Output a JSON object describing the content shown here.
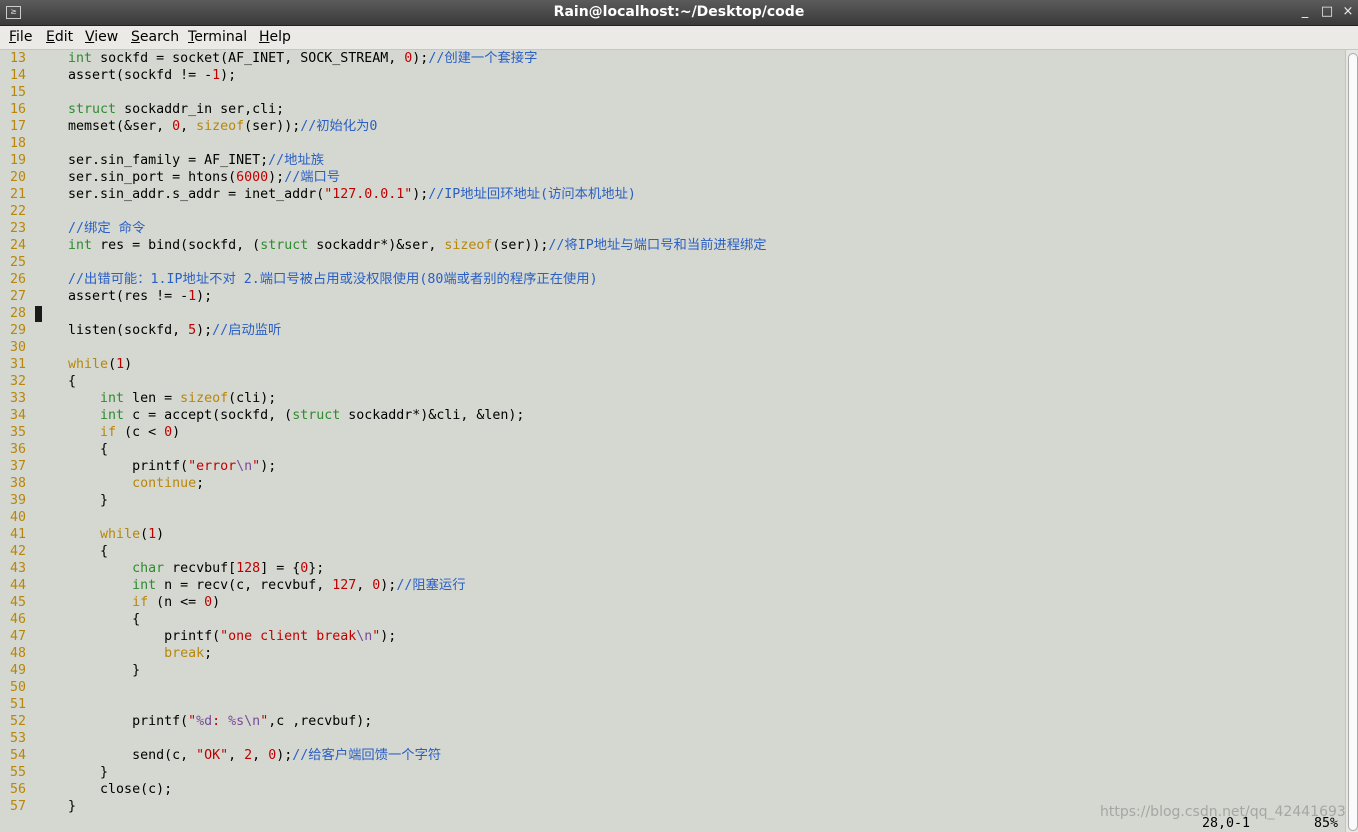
{
  "window": {
    "title": "Rain@localhost:~/Desktop/code",
    "icon": "terminal-icon",
    "controls": [
      "minimize-icon",
      "maximize-icon",
      "close-icon"
    ],
    "minimize_glyph": "_",
    "maximize_glyph": "□",
    "close_glyph": "×",
    "app_icon_glyph": "≥"
  },
  "menu": [
    {
      "pre": "",
      "u": "F",
      "post": "ile"
    },
    {
      "pre": "",
      "u": "E",
      "post": "dit"
    },
    {
      "pre": "",
      "u": "V",
      "post": "iew"
    },
    {
      "pre": "",
      "u": "S",
      "post": "earch"
    },
    {
      "pre": "",
      "u": "T",
      "post": "erminal"
    },
    {
      "pre": "",
      "u": "H",
      "post": "elp"
    }
  ],
  "editor": {
    "cursor_line": 28,
    "lines": [
      {
        "n": "13",
        "t": [
          [
            "    ",
            ""
          ],
          [
            "int",
            "type"
          ],
          [
            " sockfd = socket(AF_INET, SOCK_STREAM, ",
            ""
          ],
          [
            "0",
            "num"
          ],
          [
            ");",
            ""
          ],
          [
            "//创建一个套接字",
            "cmt"
          ]
        ]
      },
      {
        "n": "14",
        "t": [
          [
            "    assert(sockfd != -",
            ""
          ],
          [
            "1",
            "num"
          ],
          [
            ");",
            ""
          ]
        ]
      },
      {
        "n": "15",
        "t": []
      },
      {
        "n": "16",
        "t": [
          [
            "    ",
            ""
          ],
          [
            "struct",
            "type"
          ],
          [
            " sockaddr_in ser,cli;",
            ""
          ]
        ]
      },
      {
        "n": "17",
        "t": [
          [
            "    memset(&ser, ",
            ""
          ],
          [
            "0",
            "num"
          ],
          [
            ", ",
            ""
          ],
          [
            "sizeof",
            "kw"
          ],
          [
            "(ser));",
            ""
          ],
          [
            "//初始化为0",
            "cmt"
          ]
        ]
      },
      {
        "n": "18",
        "t": []
      },
      {
        "n": "19",
        "t": [
          [
            "    ser.sin_family = AF_INET;",
            ""
          ],
          [
            "//地址族",
            "cmt"
          ]
        ]
      },
      {
        "n": "20",
        "t": [
          [
            "    ser.sin_port = htons(",
            ""
          ],
          [
            "6000",
            "num"
          ],
          [
            ");",
            ""
          ],
          [
            "//端口号",
            "cmt"
          ]
        ]
      },
      {
        "n": "21",
        "t": [
          [
            "    ser.sin_addr.s_addr = inet_addr(",
            ""
          ],
          [
            "\"127.0.0.1\"",
            "str"
          ],
          [
            ");",
            ""
          ],
          [
            "//IP地址回环地址(访问本机地址)",
            "cmt"
          ]
        ]
      },
      {
        "n": "22",
        "t": []
      },
      {
        "n": "23",
        "t": [
          [
            "    ",
            ""
          ],
          [
            "//绑定 命令",
            "cmt"
          ]
        ]
      },
      {
        "n": "24",
        "t": [
          [
            "    ",
            ""
          ],
          [
            "int",
            "type"
          ],
          [
            " res = bind(sockfd, (",
            ""
          ],
          [
            "struct",
            "type"
          ],
          [
            " sockaddr*)&ser, ",
            ""
          ],
          [
            "sizeof",
            "kw"
          ],
          [
            "(ser));",
            ""
          ],
          [
            "//将IP地址与端口号和当前进程绑定",
            "cmt"
          ]
        ]
      },
      {
        "n": "25",
        "t": []
      },
      {
        "n": "26",
        "t": [
          [
            "    ",
            ""
          ],
          [
            "//出错可能：1.IP地址不对 2.端口号被占用或没权限使用(80端或者别的程序正在使用)",
            "cmt"
          ]
        ]
      },
      {
        "n": "27",
        "t": [
          [
            "    assert(res != -",
            ""
          ],
          [
            "1",
            "num"
          ],
          [
            ");",
            ""
          ]
        ]
      },
      {
        "n": "28",
        "t": []
      },
      {
        "n": "29",
        "t": [
          [
            "    listen(sockfd, ",
            ""
          ],
          [
            "5",
            "num"
          ],
          [
            ");",
            ""
          ],
          [
            "//启动监听",
            "cmt"
          ]
        ]
      },
      {
        "n": "30",
        "t": []
      },
      {
        "n": "31",
        "t": [
          [
            "    ",
            ""
          ],
          [
            "while",
            "kw"
          ],
          [
            "(",
            ""
          ],
          [
            "1",
            "num"
          ],
          [
            ")",
            ""
          ]
        ]
      },
      {
        "n": "32",
        "t": [
          [
            "    {",
            ""
          ]
        ]
      },
      {
        "n": "33",
        "t": [
          [
            "        ",
            ""
          ],
          [
            "int",
            "type"
          ],
          [
            " len = ",
            ""
          ],
          [
            "sizeof",
            "kw"
          ],
          [
            "(cli);",
            ""
          ]
        ]
      },
      {
        "n": "34",
        "t": [
          [
            "        ",
            ""
          ],
          [
            "int",
            "type"
          ],
          [
            " c = accept(sockfd, (",
            ""
          ],
          [
            "struct",
            "type"
          ],
          [
            " sockaddr*)&cli, &len);",
            ""
          ]
        ]
      },
      {
        "n": "35",
        "t": [
          [
            "        ",
            ""
          ],
          [
            "if",
            "kw"
          ],
          [
            " (c < ",
            ""
          ],
          [
            "0",
            "num"
          ],
          [
            ")",
            ""
          ]
        ]
      },
      {
        "n": "36",
        "t": [
          [
            "        {",
            ""
          ]
        ]
      },
      {
        "n": "37",
        "t": [
          [
            "            printf(",
            ""
          ],
          [
            "\"error",
            "str"
          ],
          [
            "\\n",
            "esc"
          ],
          [
            "\"",
            "str"
          ],
          [
            ");",
            ""
          ]
        ]
      },
      {
        "n": "38",
        "t": [
          [
            "            ",
            ""
          ],
          [
            "continue",
            "kw"
          ],
          [
            ";",
            ""
          ]
        ]
      },
      {
        "n": "39",
        "t": [
          [
            "        }",
            ""
          ]
        ]
      },
      {
        "n": "40",
        "t": []
      },
      {
        "n": "41",
        "t": [
          [
            "        ",
            ""
          ],
          [
            "while",
            "kw"
          ],
          [
            "(",
            ""
          ],
          [
            "1",
            "num"
          ],
          [
            ")",
            ""
          ]
        ]
      },
      {
        "n": "42",
        "t": [
          [
            "        {",
            ""
          ]
        ]
      },
      {
        "n": "43",
        "t": [
          [
            "            ",
            ""
          ],
          [
            "char",
            "type"
          ],
          [
            " recvbuf[",
            ""
          ],
          [
            "128",
            "num"
          ],
          [
            "] = {",
            ""
          ],
          [
            "0",
            "num"
          ],
          [
            "};",
            ""
          ]
        ]
      },
      {
        "n": "44",
        "t": [
          [
            "            ",
            ""
          ],
          [
            "int",
            "type"
          ],
          [
            " n = recv(c, recvbuf, ",
            ""
          ],
          [
            "127",
            "num"
          ],
          [
            ", ",
            ""
          ],
          [
            "0",
            "num"
          ],
          [
            ");",
            ""
          ],
          [
            "//阻塞运行",
            "cmt"
          ]
        ]
      },
      {
        "n": "45",
        "t": [
          [
            "            ",
            ""
          ],
          [
            "if",
            "kw"
          ],
          [
            " (n <= ",
            ""
          ],
          [
            "0",
            "num"
          ],
          [
            ")",
            ""
          ]
        ]
      },
      {
        "n": "46",
        "t": [
          [
            "            {",
            ""
          ]
        ]
      },
      {
        "n": "47",
        "t": [
          [
            "                printf(",
            ""
          ],
          [
            "\"one client break",
            "str"
          ],
          [
            "\\n",
            "esc"
          ],
          [
            "\"",
            "str"
          ],
          [
            ");",
            ""
          ]
        ]
      },
      {
        "n": "48",
        "t": [
          [
            "                ",
            ""
          ],
          [
            "break",
            "kw"
          ],
          [
            ";",
            ""
          ]
        ]
      },
      {
        "n": "49",
        "t": [
          [
            "            }",
            ""
          ]
        ]
      },
      {
        "n": "50",
        "t": []
      },
      {
        "n": "51",
        "t": []
      },
      {
        "n": "52",
        "t": [
          [
            "            printf(",
            ""
          ],
          [
            "\"",
            "str"
          ],
          [
            "%d",
            "esc"
          ],
          [
            ": ",
            "str"
          ],
          [
            "%s",
            "esc"
          ],
          [
            "\\n",
            "esc"
          ],
          [
            "\"",
            "str"
          ],
          [
            ",c ,recvbuf);",
            ""
          ]
        ]
      },
      {
        "n": "53",
        "t": []
      },
      {
        "n": "54",
        "t": [
          [
            "            send(c, ",
            ""
          ],
          [
            "\"OK\"",
            "str"
          ],
          [
            ", ",
            ""
          ],
          [
            "2",
            "num"
          ],
          [
            ", ",
            ""
          ],
          [
            "0",
            "num"
          ],
          [
            ");",
            ""
          ],
          [
            "//给客户端回馈一个字符",
            "cmt"
          ]
        ]
      },
      {
        "n": "55",
        "t": [
          [
            "        }",
            ""
          ]
        ]
      },
      {
        "n": "56",
        "t": [
          [
            "        close(c);",
            ""
          ]
        ]
      },
      {
        "n": "57",
        "t": [
          [
            "    }",
            ""
          ]
        ]
      }
    ]
  },
  "status": {
    "position": "28,0-1",
    "percent": "85%"
  },
  "watermark": "https://blog.csdn.net/qq_42441693"
}
